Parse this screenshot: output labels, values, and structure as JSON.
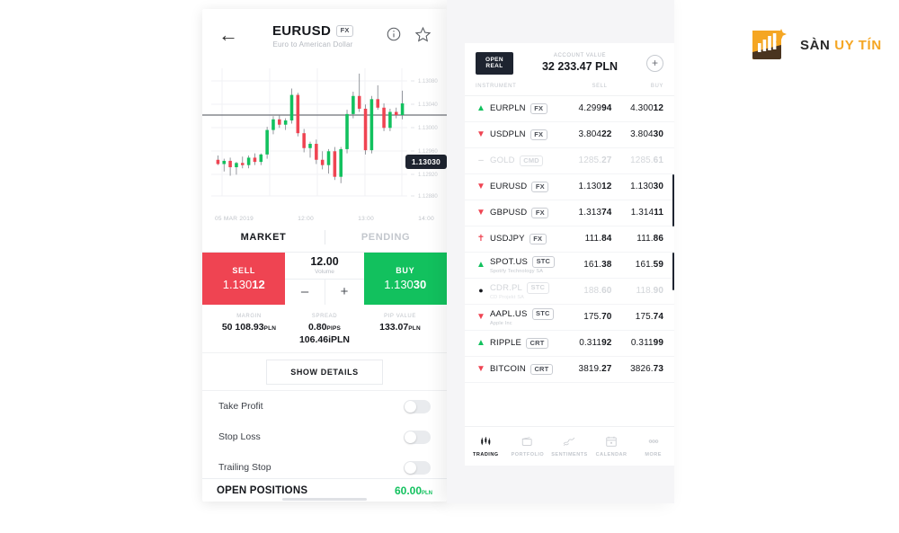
{
  "left_phone": {
    "header": {
      "back_icon": "back-arrow-icon",
      "symbol": "EURUSD",
      "symbol_badge": "FX",
      "subtitle": "Euro to American Dollar",
      "info_icon": "info-icon",
      "star_icon": "star-icon"
    },
    "chart": {
      "current_price_tag": "1.13030",
      "y_labels": [
        "1.13080",
        "1.13040",
        "1.13000",
        "1.12960",
        "1.12920",
        "1.12880"
      ],
      "x_labels": [
        "05 MAR 2019",
        "12:00",
        "13:00",
        "14:00"
      ]
    },
    "tabs": {
      "market": "MARKET",
      "pending": "PENDING"
    },
    "trade": {
      "sell_label": "SELL",
      "sell_price_main": "1.130",
      "sell_price_bold": "12",
      "buy_label": "BUY",
      "buy_price_main": "1.130",
      "buy_price_bold": "30",
      "volume_value": "12.00",
      "volume_label": "Volume",
      "minus": "–",
      "plus": "+"
    },
    "stats": [
      {
        "label": "MARGIN",
        "value": "50 108.93",
        "unit": "PLN",
        "value2": "",
        "unit2": ""
      },
      {
        "label": "SPREAD",
        "value": "0.80",
        "unit": "PIPS",
        "value2": "106.46",
        "unit2": "iPLN"
      },
      {
        "label": "PIP VALUE",
        "value": "133.07",
        "unit": "PLN",
        "value2": "",
        "unit2": ""
      }
    ],
    "show_details": "SHOW DETAILS",
    "toggles": [
      {
        "label": "Take Profit",
        "on": false
      },
      {
        "label": "Stop Loss",
        "on": false
      },
      {
        "label": "Trailing Stop",
        "on": false
      }
    ],
    "open_positions": {
      "label": "OPEN POSITIONS",
      "value": "60.00",
      "unit": "PLN"
    }
  },
  "right_phone": {
    "account": {
      "open_real_line1": "OPEN",
      "open_real_line2": "REAL",
      "value_label": "ACCOUNT VALUE",
      "value": "32 233.47 PLN",
      "plus_icon": "plus-circle-icon"
    },
    "columns": {
      "instrument": "INSTRUMENT",
      "sell": "SELL",
      "buy": "BUY"
    },
    "instruments": [
      {
        "arrow": "up",
        "name": "EURPLN",
        "badge": "FX",
        "sub": "",
        "sell_main": "4.299",
        "sell_bold": "94",
        "buy_main": "4.300",
        "buy_bold": "12",
        "dim": false
      },
      {
        "arrow": "down",
        "name": "USDPLN",
        "badge": "FX",
        "sub": "",
        "sell_main": "3.804",
        "sell_bold": "22",
        "buy_main": "3.804",
        "buy_bold": "30",
        "dim": false
      },
      {
        "arrow": "flat",
        "name": "GOLD",
        "badge": "CMD",
        "sub": "",
        "sell_main": "1285.",
        "sell_bold": "27",
        "buy_main": "1285.",
        "buy_bold": "61",
        "dim": true
      },
      {
        "arrow": "down",
        "name": "EURUSD",
        "badge": "FX",
        "sub": "",
        "sell_main": "1.130",
        "sell_bold": "12",
        "buy_main": "1.130",
        "buy_bold": "30",
        "dim": false
      },
      {
        "arrow": "down",
        "name": "GBPUSD",
        "badge": "FX",
        "sub": "",
        "sell_main": "1.313",
        "sell_bold": "74",
        "buy_main": "1.314",
        "buy_bold": "11",
        "dim": false
      },
      {
        "arrow": "mixed",
        "name": "USDJPY",
        "badge": "FX",
        "sub": "",
        "sell_main": "111.",
        "sell_bold": "84",
        "buy_main": "111.",
        "buy_bold": "86",
        "dim": false
      },
      {
        "arrow": "up",
        "name": "SPOT.US",
        "badge": "STC",
        "sub": "Spotify Technology SA",
        "sell_main": "161.",
        "sell_bold": "38",
        "buy_main": "161.",
        "buy_bold": "59",
        "dim": false
      },
      {
        "arrow": "dot",
        "name": "CDR.PL",
        "badge": "STC",
        "sub": "CD Projekt SA",
        "sell_main": "188.",
        "sell_bold": "60",
        "buy_main": "118.",
        "buy_bold": "90",
        "dim": true
      },
      {
        "arrow": "down",
        "name": "AAPL.US",
        "badge": "STC",
        "sub": "Apple Inc",
        "sell_main": "175.",
        "sell_bold": "70",
        "buy_main": "175.",
        "buy_bold": "74",
        "dim": false
      },
      {
        "arrow": "up",
        "name": "RIPPLE",
        "badge": "CRT",
        "sub": "",
        "sell_main": "0.311",
        "sell_bold": "92",
        "buy_main": "0.311",
        "buy_bold": "99",
        "dim": false
      },
      {
        "arrow": "down",
        "name": "BITCOIN",
        "badge": "CRT",
        "sub": "",
        "sell_main": "3819.",
        "sell_bold": "27",
        "buy_main": "3826.",
        "buy_bold": "73",
        "dim": false
      }
    ],
    "bottom_nav": [
      {
        "label": "TRADING",
        "icon": "candlestick-icon",
        "active": true
      },
      {
        "label": "PORTFOLIO",
        "icon": "wallet-icon",
        "active": false
      },
      {
        "label": "SENTIMENTS",
        "icon": "line-chart-icon",
        "active": false
      },
      {
        "label": "CALENDAR",
        "icon": "calendar-icon",
        "active": false
      },
      {
        "label": "MORE",
        "icon": "more-dots-icon",
        "active": false
      }
    ]
  },
  "logo": {
    "text1": "SÀN",
    "text2": "UY TÍN",
    "mark": "bar-chart-star-logo"
  },
  "colors": {
    "sell_red": "#ef4452",
    "buy_green": "#12c15e",
    "dark": "#1e2430",
    "brand_orange": "#f5a623"
  },
  "chart_data": {
    "type": "candlestick",
    "title": "EURUSD",
    "ylim": [
      1.1286,
      1.131
    ],
    "xlabel": "",
    "ylabel": "",
    "grid": true,
    "current_price": 1.1303,
    "candles": [
      {
        "o": 1.12928,
        "h": 1.12936,
        "l": 1.12918,
        "c": 1.1292,
        "dir": "down"
      },
      {
        "o": 1.1292,
        "h": 1.1293,
        "l": 1.12906,
        "c": 1.12926,
        "dir": "up"
      },
      {
        "o": 1.12926,
        "h": 1.12932,
        "l": 1.12898,
        "c": 1.12914,
        "dir": "down"
      },
      {
        "o": 1.12914,
        "h": 1.12924,
        "l": 1.129,
        "c": 1.12922,
        "dir": "up"
      },
      {
        "o": 1.12922,
        "h": 1.12934,
        "l": 1.12912,
        "c": 1.12918,
        "dir": "down"
      },
      {
        "o": 1.12918,
        "h": 1.12936,
        "l": 1.12912,
        "c": 1.12932,
        "dir": "up"
      },
      {
        "o": 1.12932,
        "h": 1.1294,
        "l": 1.12918,
        "c": 1.12924,
        "dir": "down"
      },
      {
        "o": 1.12924,
        "h": 1.1294,
        "l": 1.12918,
        "c": 1.12938,
        "dir": "up"
      },
      {
        "o": 1.12938,
        "h": 1.1299,
        "l": 1.1293,
        "c": 1.12984,
        "dir": "up"
      },
      {
        "o": 1.12984,
        "h": 1.1301,
        "l": 1.12976,
        "c": 1.13004,
        "dir": "up"
      },
      {
        "o": 1.13004,
        "h": 1.13012,
        "l": 1.12988,
        "c": 1.12994,
        "dir": "down"
      },
      {
        "o": 1.12994,
        "h": 1.13006,
        "l": 1.12984,
        "c": 1.13002,
        "dir": "up"
      },
      {
        "o": 1.13002,
        "h": 1.13062,
        "l": 1.12996,
        "c": 1.1305,
        "dir": "up"
      },
      {
        "o": 1.1305,
        "h": 1.13054,
        "l": 1.12972,
        "c": 1.12978,
        "dir": "down"
      },
      {
        "o": 1.12978,
        "h": 1.12986,
        "l": 1.12942,
        "c": 1.1295,
        "dir": "down"
      },
      {
        "o": 1.1295,
        "h": 1.12962,
        "l": 1.12932,
        "c": 1.12958,
        "dir": "up"
      },
      {
        "o": 1.12958,
        "h": 1.12966,
        "l": 1.1292,
        "c": 1.12928,
        "dir": "down"
      },
      {
        "o": 1.12928,
        "h": 1.12944,
        "l": 1.1291,
        "c": 1.12918,
        "dir": "down"
      },
      {
        "o": 1.12918,
        "h": 1.12948,
        "l": 1.12902,
        "c": 1.12944,
        "dir": "up"
      },
      {
        "o": 1.12944,
        "h": 1.12952,
        "l": 1.1289,
        "c": 1.12896,
        "dir": "down"
      },
      {
        "o": 1.12896,
        "h": 1.12952,
        "l": 1.12884,
        "c": 1.12948,
        "dir": "up"
      },
      {
        "o": 1.12948,
        "h": 1.13022,
        "l": 1.1294,
        "c": 1.13014,
        "dir": "up"
      },
      {
        "o": 1.13014,
        "h": 1.13056,
        "l": 1.13006,
        "c": 1.13048,
        "dir": "up"
      },
      {
        "o": 1.13048,
        "h": 1.1309,
        "l": 1.13018,
        "c": 1.13024,
        "dir": "down"
      },
      {
        "o": 1.13024,
        "h": 1.13032,
        "l": 1.12938,
        "c": 1.12946,
        "dir": "down"
      },
      {
        "o": 1.12946,
        "h": 1.13048,
        "l": 1.1294,
        "c": 1.13042,
        "dir": "up"
      },
      {
        "o": 1.13042,
        "h": 1.13068,
        "l": 1.13022,
        "c": 1.13026,
        "dir": "down"
      },
      {
        "o": 1.13026,
        "h": 1.13034,
        "l": 1.12982,
        "c": 1.12988,
        "dir": "down"
      },
      {
        "o": 1.12988,
        "h": 1.13024,
        "l": 1.12982,
        "c": 1.13018,
        "dir": "up"
      },
      {
        "o": 1.13018,
        "h": 1.13026,
        "l": 1.13006,
        "c": 1.13012,
        "dir": "down"
      },
      {
        "o": 1.13012,
        "h": 1.13058,
        "l": 1.13004,
        "c": 1.13034,
        "dir": "up"
      }
    ]
  }
}
